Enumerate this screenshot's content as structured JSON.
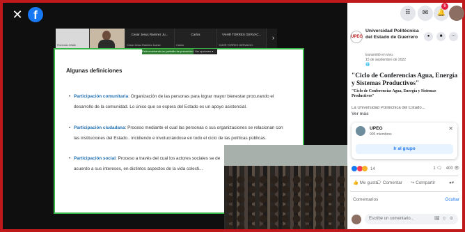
{
  "viewer": {
    "close_glyph": "✕",
    "logo_glyph": "f",
    "participants": [
      {
        "name": "",
        "sub": "Florencio Oñate"
      },
      {
        "name": "",
        "sub": ""
      },
      {
        "name": "Cesar Jesus Ramirez Ju...",
        "sub": "Cesar Jesus Ramirez Juarez"
      },
      {
        "name": "Carlos",
        "sub": "Carlos"
      },
      {
        "name": "YAHIR TORRES GERVAC...",
        "sub": "YAHIR TORRES GERVACIO"
      }
    ],
    "share_notice": "Está mostrando su pantalla de presentación",
    "share_options": "Ver opciones ▾",
    "slide": {
      "heading": "Algunas definiciones",
      "bullets": [
        {
          "term": "Participación comunitaria",
          "text": ": Organización de las personas para lograr mayor bienestar procurando el desarrollo de la comunidad. Lo único que se espera del Estado es un apoyo asistencial."
        },
        {
          "term": "Participación ciudadana",
          "text": ": Proceso mediante el cual las personas o sus organizaciones se relacionan con las instituciones del Estado.. incidiendo e involucrándose en todo el ciclo de las políticas públicas."
        },
        {
          "term": "Participación social",
          "text": ": Proceso a través del cual los actores sociales se de acuerdo a sus intereses, en distintos aspectos de la vida colecti..."
        }
      ]
    }
  },
  "topbar": {
    "grid_icon": "⠿",
    "messenger_icon": "✉",
    "bell_icon": "🔔",
    "notif_count": "6"
  },
  "post": {
    "page_name": "Universidad Politécnica del Estado de Guerrero",
    "page_logo_text": "UPEG",
    "transmitted": "transmitió en vivo.",
    "date": "15 de septiembre de 2022",
    "privacy_glyph": "🌐",
    "title": "\"Ciclo de Conferencias Agua, Energía y Sistemas Productivos\"",
    "subtitle": "\"Ciclo de Conferencias Agua, Energía y Sistemas Productivos\"",
    "description": "La Universidad Politécnica del Estado...",
    "see_more": "Ver más",
    "group": {
      "name": "UPEG",
      "members": "905 miembros",
      "button": "Ir al grupo",
      "close": "✕"
    },
    "reactions_count": "14",
    "comments_count": "1 🗨",
    "views": "400 👁",
    "actions": {
      "like": "Me gusta",
      "comment": "Comentar",
      "share": "Compartir"
    },
    "comments_label": "Comentarios",
    "hide_label": "Ocultar",
    "comment_placeholder": "Escribe un comentario...",
    "comment_icons": [
      "🖼",
      "☺",
      "⊙"
    ]
  },
  "colors": {
    "frame": "#c0191c",
    "accent": "#1877f2",
    "slide_border": "#3bb54a"
  }
}
